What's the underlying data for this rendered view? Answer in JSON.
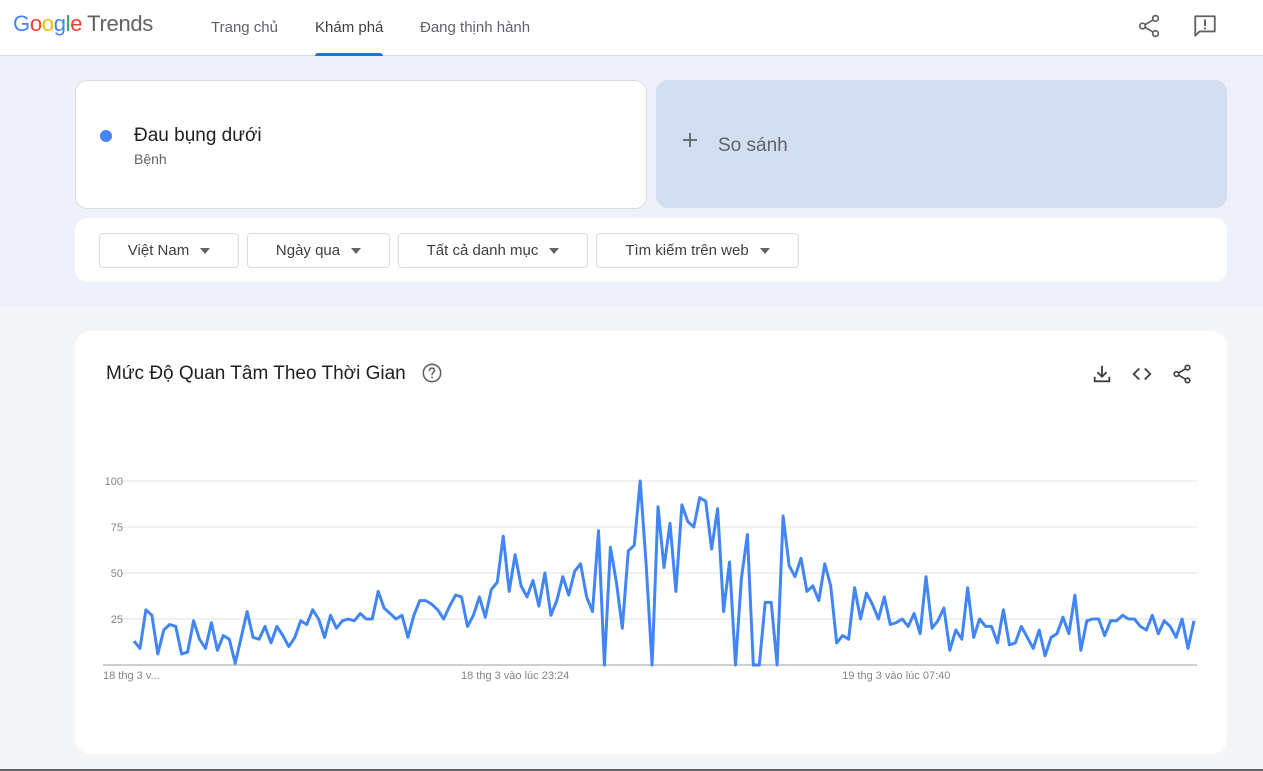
{
  "header": {
    "logo_google": "Google",
    "logo_trends": "Trends",
    "nav": [
      {
        "label": "Trang chủ"
      },
      {
        "label": "Khám phá",
        "active": true
      },
      {
        "label": "Đang thịnh hành"
      }
    ],
    "icons": [
      "share-icon",
      "feedback-icon"
    ]
  },
  "search_term": {
    "name": "Đau bụng dưới",
    "type": "Bệnh",
    "color": "#4285f4"
  },
  "compare": {
    "label": "So sánh",
    "icon": "plus-icon"
  },
  "filters": [
    {
      "label": "Việt Nam"
    },
    {
      "label": "Ngày qua"
    },
    {
      "label": "Tất cả danh mục"
    },
    {
      "label": "Tìm kiếm trên web"
    }
  ],
  "chart_card": {
    "title": "Mức Độ Quan Tâm Theo Thời Gian",
    "icons": [
      "help-icon",
      "download-icon",
      "embed-code-icon",
      "share-icon"
    ]
  },
  "colors": {
    "accent": "#1a73e8",
    "series": "#4285f4",
    "band_bg": "#eef1f9",
    "compare_bg": "#d2def2"
  },
  "chart_data": {
    "type": "line",
    "ylim": [
      0,
      100
    ],
    "y_ticks": [
      "100",
      "75",
      "50",
      "25"
    ],
    "x_labels": [
      {
        "index": 0,
        "text": "18 thg 3 v..."
      },
      {
        "index": 64,
        "text": "18 thg 3 vào lúc 23:24"
      },
      {
        "index": 128,
        "text": "19 thg 3 vào lúc 07:40"
      }
    ],
    "grid": true,
    "series": [
      {
        "values": [
          13,
          9,
          30,
          27,
          6,
          19,
          22,
          21,
          6,
          7,
          24,
          14,
          9,
          23,
          8,
          16,
          14,
          1,
          15,
          29,
          15,
          14,
          21,
          12,
          21,
          16,
          10,
          15,
          24,
          22,
          30,
          25,
          15,
          27,
          20,
          24,
          25,
          24,
          28,
          25,
          25,
          40,
          31,
          28,
          25,
          27,
          15,
          27,
          35,
          35,
          33,
          30,
          25,
          32,
          38,
          37,
          21,
          27,
          37,
          26,
          41,
          45,
          70,
          40,
          60,
          43,
          37,
          46,
          32,
          50,
          27,
          35,
          48,
          38,
          51,
          55,
          37,
          29,
          73,
          0,
          64,
          45,
          20,
          62,
          65,
          100,
          55,
          0,
          86,
          53,
          77,
          40,
          87,
          78,
          75,
          91,
          89,
          63,
          85,
          29,
          56,
          0,
          47,
          71,
          0,
          0,
          34,
          34,
          0,
          81,
          54,
          48,
          58,
          40,
          43,
          35,
          55,
          43,
          12,
          16,
          14,
          42,
          25,
          39,
          33,
          25,
          37,
          22,
          23,
          25,
          21,
          28,
          17,
          48,
          20,
          24,
          31,
          8,
          19,
          14,
          42,
          15,
          25,
          21,
          21,
          12,
          30,
          11,
          12,
          21,
          15,
          9,
          19,
          5,
          15,
          17,
          26,
          17,
          38,
          8,
          24,
          25,
          25,
          16,
          24,
          24,
          27,
          25,
          25,
          21,
          19,
          27,
          17,
          24,
          21,
          15,
          25,
          9,
          24
        ]
      }
    ]
  }
}
